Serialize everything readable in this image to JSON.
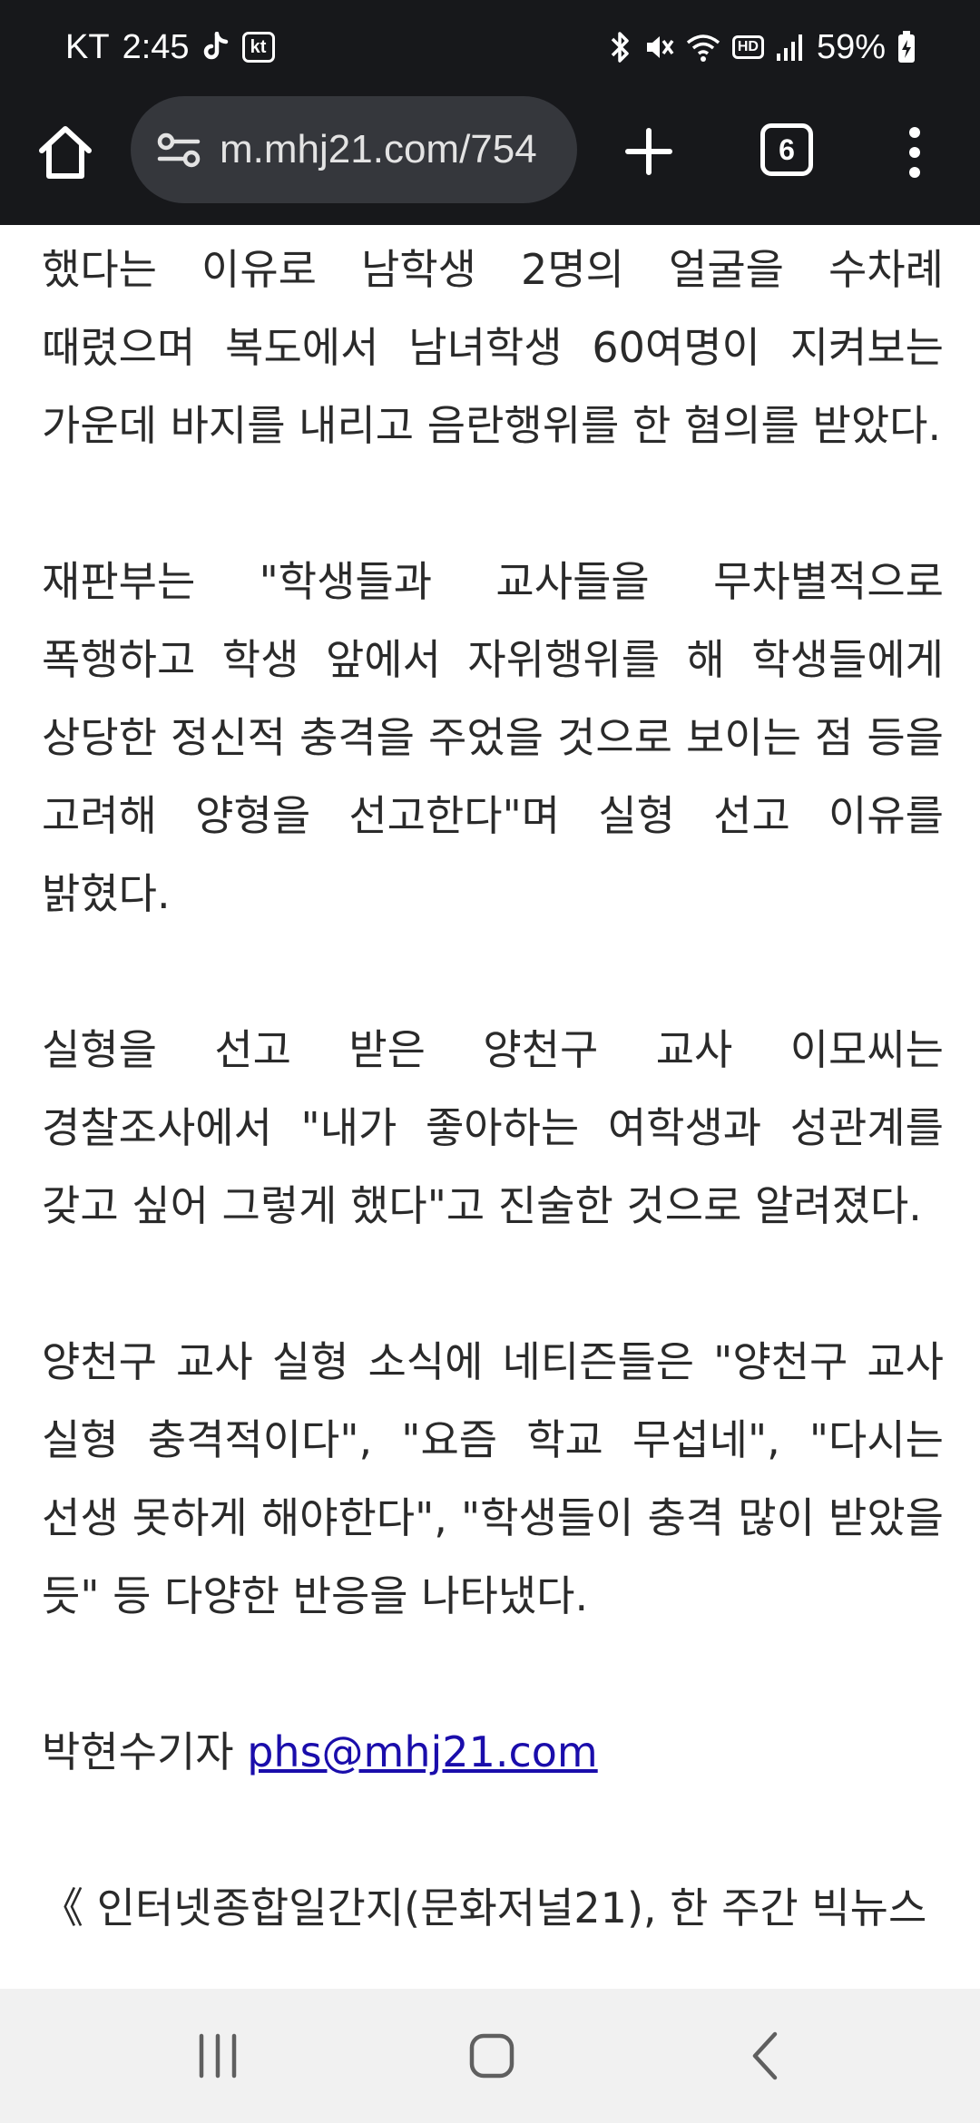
{
  "status_bar": {
    "carrier": "KT",
    "time": "2:45",
    "icons": [
      "tiktok-icon",
      "kt-app-icon",
      "bluetooth-icon",
      "mute-icon",
      "wifi-icon",
      "hd-voice-icon",
      "signal-icon",
      "battery-charging-icon"
    ],
    "kt_label": "kt",
    "hd_label": "HD",
    "battery_percent": "59%"
  },
  "browser": {
    "url": "m.mhj21.com/754",
    "tab_count": "6",
    "icons": [
      "home-icon",
      "site-settings-icon",
      "new-tab-icon",
      "tab-switcher-icon",
      "more-menu-icon"
    ]
  },
  "article": {
    "paragraphs": [
      "했다는 이유로 남학생 2명의 얼굴을 수차례 때렸으며 복도에서 남녀학생 60여명이 지켜보는 가운데 바지를 내리고 음란행위를 한 혐의를 받았다.",
      "재판부는 \"학생들과 교사들을 무차별적으로 폭행하고 학생 앞에서 자위행위를 해 학생들에게 상당한 정신적 충격을 주었을 것으로 보이는 점 등을 고려해 양형을 선고한다\"며 실형 선고 이유를 밝혔다.",
      "실형을 선고 받은 양천구 교사 이모씨는 경찰조사에서 \"내가 좋아하는 여학생과 성관계를 갖고 싶어 그렇게 했다\"고 진술한 것으로 알려졌다.",
      "양천구 교사 실형 소식에 네티즌들은 \"양천구 교사 실형 충격적이다\", \"요즘 학교 무섭네\", \"다시는 선생 못하게 해야한다\", \"학생들이 충격 많이 받았을 듯\" 등 다양한 반응을 나타냈다."
    ],
    "byline_name": "박현수기자",
    "byline_email": "phs@mhj21.com",
    "footer_text": "《 인터넷종합일간지(문화저널21), 한 주간 빅뉴스"
  },
  "navigation_bar": {
    "icons": [
      "recent-apps-icon",
      "home-button-icon",
      "back-icon"
    ]
  },
  "colors": {
    "status_bar_bg": "#17181b",
    "url_bar_bg": "#35373c",
    "text": "#2a2a2a",
    "link": "#1a0dab",
    "nav_bar_bg": "#f1f1f1"
  }
}
